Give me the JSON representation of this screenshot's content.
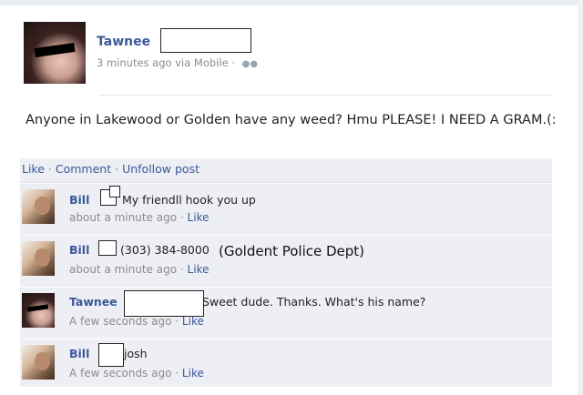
{
  "post": {
    "author": "Tawnee",
    "time": "3 minutes ago via Mobile",
    "separator": "·",
    "audience_icon": "people-icon",
    "text": "Anyone in Lakewood or Golden have any weed? Hmu PLEASE! I NEED A GRAM.(:"
  },
  "actions": {
    "like": "Like",
    "comment": "Comment",
    "unfollow": "Unfollow post",
    "sep": "·"
  },
  "comments": [
    {
      "author": "Bill",
      "text": "My friendll hook you up",
      "time": "about a minute ago",
      "like": "Like"
    },
    {
      "author": "Bill",
      "text": "(303) 384-8000",
      "annotation": "(Goldent Police Dept)",
      "time": "about a minute ago",
      "like": "Like"
    },
    {
      "author": "Tawnee",
      "text": "Sweet dude. Thanks. What's his name?",
      "time": "A few seconds ago",
      "like": "Like"
    },
    {
      "author": "Bill",
      "text": "josh",
      "time": "A few seconds ago",
      "like": "Like"
    }
  ],
  "colors": {
    "link": "#3b5998",
    "bar": "#edeff4"
  }
}
